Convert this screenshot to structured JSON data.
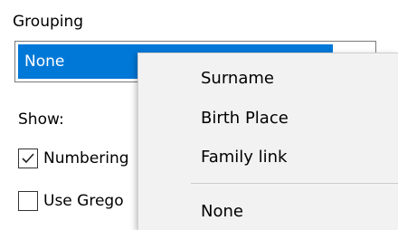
{
  "grouping": {
    "label": "Grouping",
    "selected": "None"
  },
  "show": {
    "label": "Show:",
    "checkboxes": [
      {
        "label": "Numbering",
        "checked": true
      },
      {
        "label": "Use Grego",
        "checked": false
      }
    ]
  },
  "dropdown_menu": {
    "items": [
      "Surname",
      "Birth Place",
      "Family link",
      "None"
    ]
  },
  "colors": {
    "selection": "#0078d7",
    "menu_background": "#f2f2f2"
  },
  "icons": {
    "combo_arrow": "chevron-down-icon",
    "check": "checkmark-icon"
  }
}
